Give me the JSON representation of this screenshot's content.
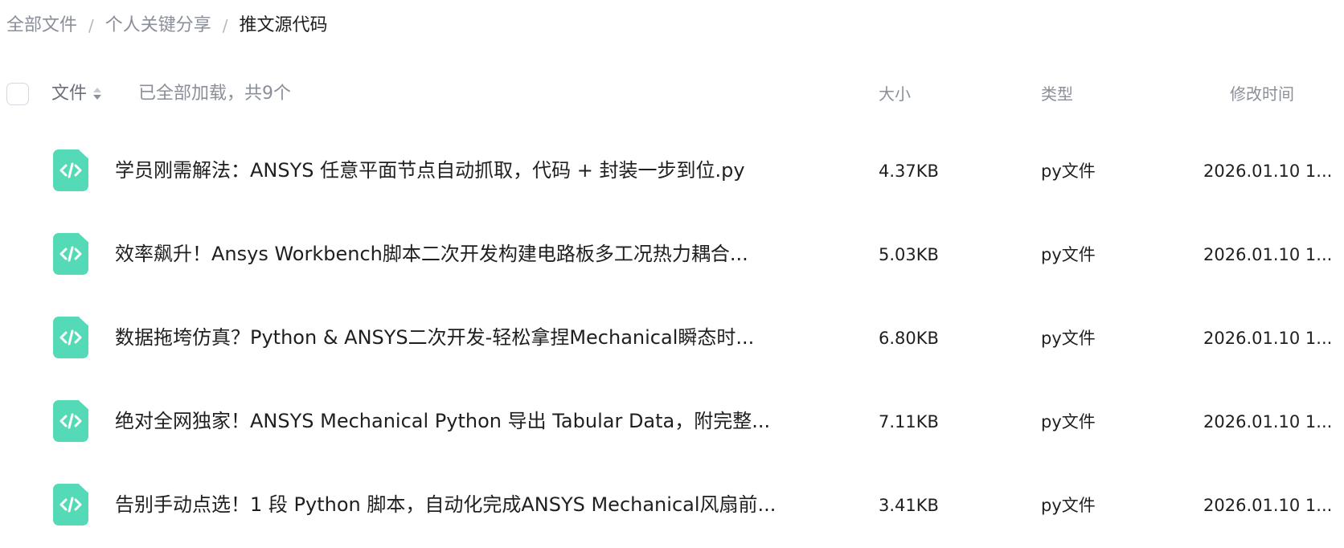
{
  "breadcrumb": {
    "items": [
      "全部文件",
      "个人关键分享",
      "推文源代码"
    ],
    "separator": "/"
  },
  "header": {
    "file_label": "文件",
    "status": "已全部加载，共9个",
    "size_label": "大小",
    "type_label": "类型",
    "mtime_label": "修改时间"
  },
  "files": [
    {
      "icon": "python-code-file-icon",
      "name": "学员刚需解法：ANSYS 任意平面节点自动抓取，代码 + 封装一步到位.py",
      "size": "4.37KB",
      "type": "py文件",
      "mtime": "2026.01.10 1..."
    },
    {
      "icon": "python-code-file-icon",
      "name": "效率飙升！Ansys Workbench脚本二次开发构建电路板多工况热力耦合...",
      "size": "5.03KB",
      "type": "py文件",
      "mtime": "2026.01.10 1..."
    },
    {
      "icon": "python-code-file-icon",
      "name": "数据拖垮仿真？Python & ANSYS二次开发-轻松拿捏Mechanical瞬态时...",
      "size": "6.80KB",
      "type": "py文件",
      "mtime": "2026.01.10 1..."
    },
    {
      "icon": "python-code-file-icon",
      "name": "绝对全网独家！ANSYS Mechanical Python 导出 Tabular Data，附完整...",
      "size": "7.11KB",
      "type": "py文件",
      "mtime": "2026.01.10 1..."
    },
    {
      "icon": "python-code-file-icon",
      "name": "告别手动点选！1 段 Python 脚本，自动化完成ANSYS Mechanical风扇前...",
      "size": "3.41KB",
      "type": "py文件",
      "mtime": "2026.01.10 1..."
    }
  ],
  "colors": {
    "icon_green": "#55dab7",
    "text_primary": "#1f1f1f",
    "text_secondary": "#8a8f99"
  }
}
